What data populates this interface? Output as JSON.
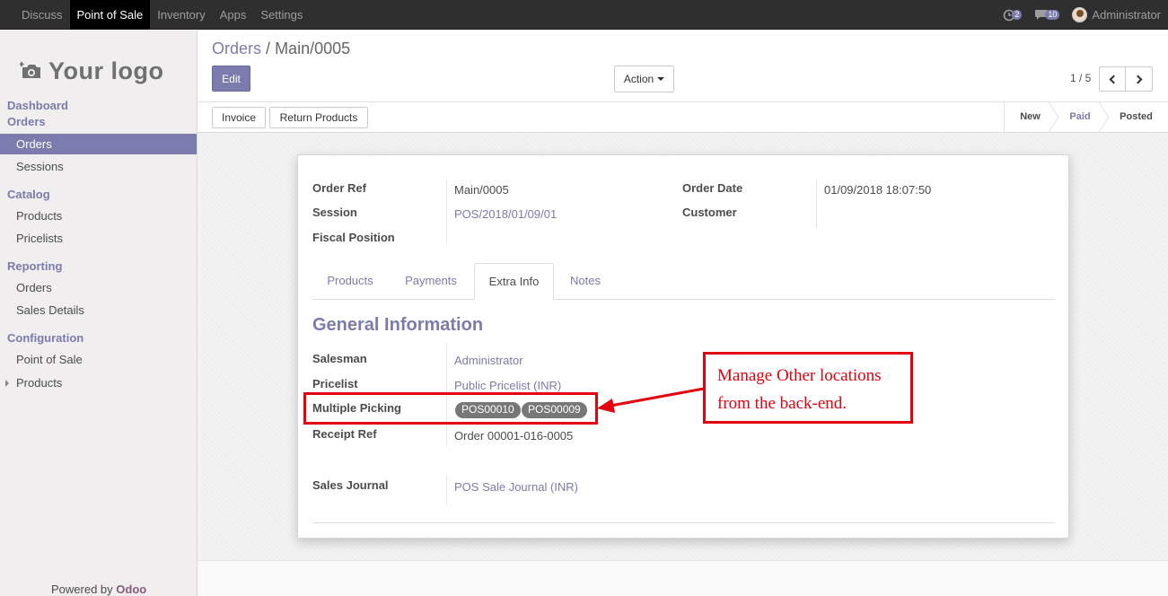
{
  "navbar": {
    "menu": [
      "Discuss",
      "Point of Sale",
      "Inventory",
      "Apps",
      "Settings"
    ],
    "active": "Point of Sale",
    "activity_count": "2",
    "message_count": "10",
    "user_name": "Administrator"
  },
  "sidebar": {
    "logo_text": "Your logo",
    "dashboard": "Dashboard",
    "orders_head": "Orders",
    "orders_item": "Orders",
    "sessions": "Sessions",
    "catalog_head": "Catalog",
    "products": "Products",
    "pricelists": "Pricelists",
    "reporting_head": "Reporting",
    "rep_orders": "Orders",
    "sales_details": "Sales Details",
    "config_head": "Configuration",
    "point_of_sale": "Point of Sale",
    "config_products": "Products",
    "powered_by": "Powered by",
    "brand": "Odoo"
  },
  "control": {
    "breadcrumb_parent": "Orders",
    "breadcrumb_sep": "/",
    "breadcrumb_current": "Main/0005",
    "edit_label": "Edit",
    "action_label": "Action",
    "pager_text": "1 / 5"
  },
  "statusbar": {
    "invoice_label": "Invoice",
    "return_label": "Return Products",
    "stages": [
      "New",
      "Paid",
      "Posted"
    ],
    "current_stage": "Paid"
  },
  "form": {
    "order_ref_label": "Order Ref",
    "order_ref": "Main/0005",
    "session_label": "Session",
    "session": "POS/2018/01/09/01",
    "fiscal_label": "Fiscal Position",
    "order_date_label": "Order Date",
    "order_date": "01/09/2018 18:07:50",
    "customer_label": "Customer",
    "tabs": [
      "Products",
      "Payments",
      "Extra Info",
      "Notes"
    ],
    "active_tab": "Extra Info",
    "section_title": "General Information",
    "salesman_label": "Salesman",
    "salesman": "Administrator",
    "pricelist_label": "Pricelist",
    "pricelist": "Public Pricelist (INR)",
    "multiple_picking_label": "Multiple Picking",
    "pickings": [
      "POS00010",
      "POS00009"
    ],
    "receipt_label": "Receipt Ref",
    "receipt": "Order 00001-016-0005",
    "journal_label": "Sales Journal",
    "journal": "POS Sale Journal (INR)"
  },
  "annotation": {
    "line1": "Manage Other locations",
    "line2": "from the back-end.",
    "color": "#e3000f"
  },
  "colors": {
    "accent": "#7c7bad",
    "navbar": "#2f2f2f"
  }
}
